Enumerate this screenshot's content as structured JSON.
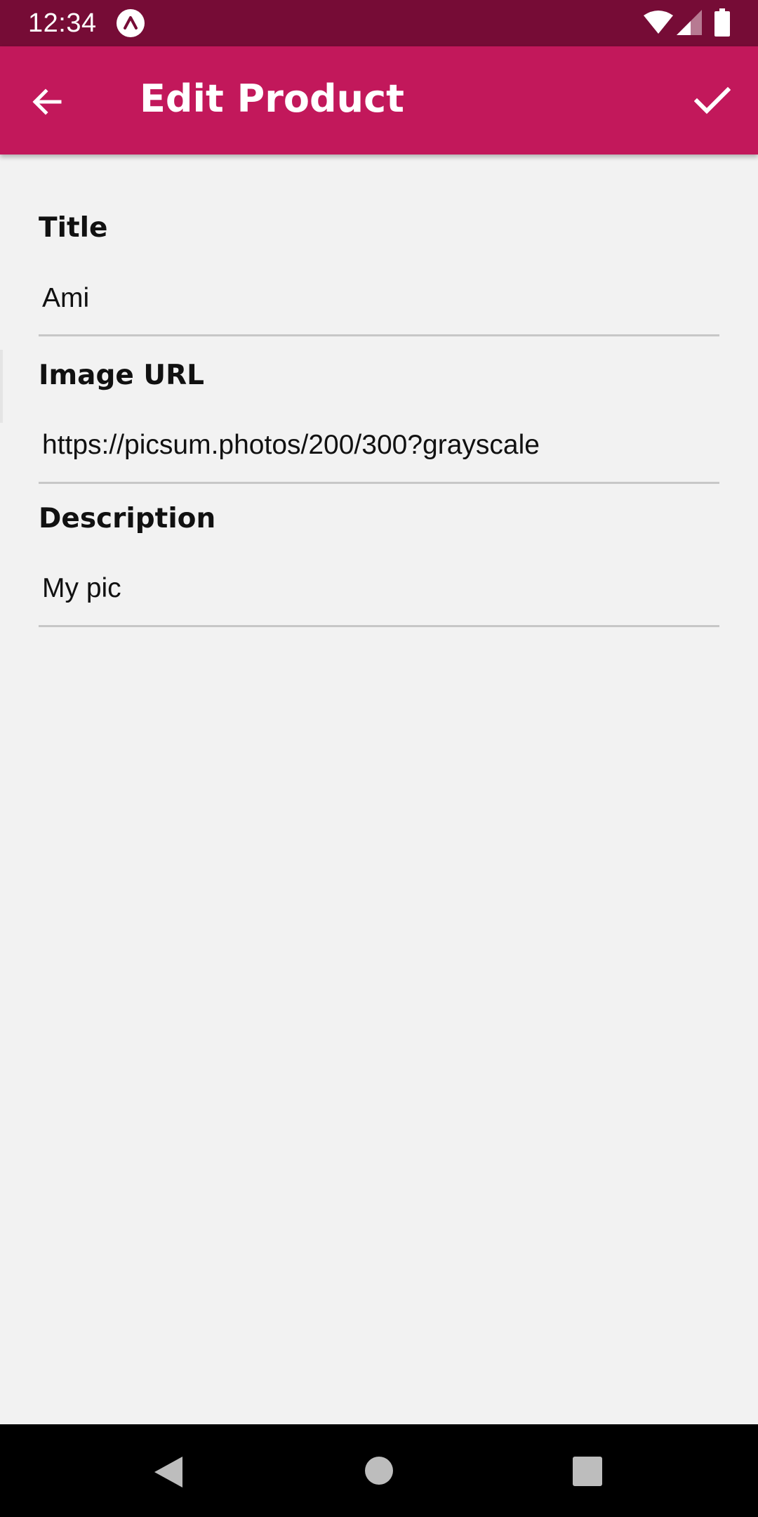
{
  "status_bar": {
    "time": "12:34",
    "icons": [
      "expo-app-icon",
      "wifi-icon",
      "signal-icon",
      "battery-icon"
    ]
  },
  "app_bar": {
    "title": "Edit Product",
    "back_icon": "arrow-back-icon",
    "save_icon": "check-icon",
    "color": "#c2185b",
    "status_color": "#760c36"
  },
  "form": {
    "fields": [
      {
        "label": "Title",
        "value": "Ami"
      },
      {
        "label": "Image URL",
        "value": "https://picsum.photos/200/300?grayscale"
      },
      {
        "label": "Description",
        "value": "My pic"
      }
    ]
  },
  "nav_bar": {
    "icons": [
      "nav-back-icon",
      "nav-home-icon",
      "nav-recents-icon"
    ]
  }
}
